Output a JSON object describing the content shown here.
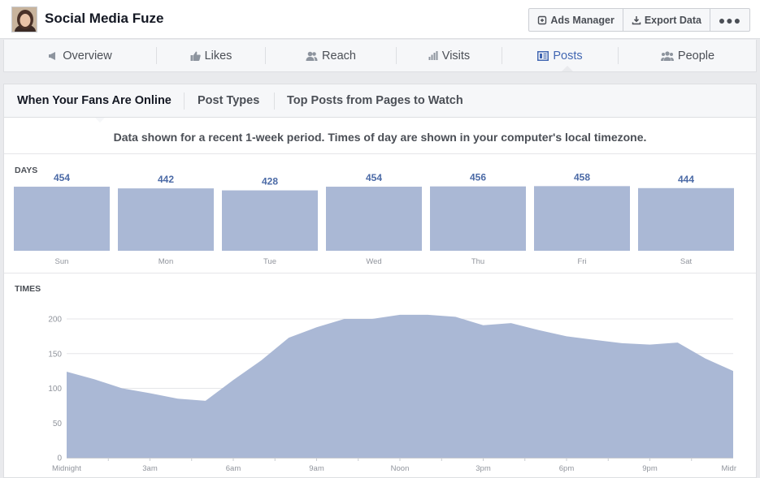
{
  "page": {
    "name": "Social Media Fuze"
  },
  "header_buttons": {
    "ads_manager": "Ads Manager",
    "export_data": "Export Data",
    "more": "●●●"
  },
  "nav": {
    "tabs": [
      {
        "label": "Overview",
        "icon": "megaphone-icon"
      },
      {
        "label": "Likes",
        "icon": "thumbs-up-icon"
      },
      {
        "label": "Reach",
        "icon": "people-icon"
      },
      {
        "label": "Visits",
        "icon": "bar-chart-icon"
      },
      {
        "label": "Posts",
        "icon": "posts-icon",
        "active": true
      },
      {
        "label": "People",
        "icon": "group-icon"
      }
    ]
  },
  "subtabs": [
    "When Your Fans Are Online",
    "Post Types",
    "Top Posts from Pages to Watch"
  ],
  "note": "Data shown for a recent 1-week period. Times of day are shown in your computer's local timezone.",
  "colors": {
    "bar": "#aab8d5",
    "value_label": "#4b6aa6",
    "active_tab": "#4267b2"
  },
  "chart_data": [
    {
      "type": "bar",
      "title": "DAYS",
      "categories": [
        "Sun",
        "Mon",
        "Tue",
        "Wed",
        "Thu",
        "Fri",
        "Sat"
      ],
      "values": [
        454,
        442,
        428,
        454,
        456,
        458,
        444
      ]
    },
    {
      "type": "area",
      "title": "TIMES",
      "x_ticks": [
        "Midnight",
        "3am",
        "6am",
        "9am",
        "Noon",
        "3pm",
        "6pm",
        "9pm",
        "Midr"
      ],
      "x": [
        0,
        1,
        2,
        3,
        4,
        5,
        6,
        7,
        8,
        9,
        10,
        11,
        12,
        13,
        14,
        15,
        16,
        17,
        18,
        19,
        20,
        21,
        22,
        23,
        24
      ],
      "values": [
        124,
        113,
        100,
        93,
        85,
        82,
        112,
        140,
        173,
        188,
        200,
        200,
        206,
        206,
        203,
        191,
        194,
        184,
        175,
        170,
        165,
        163,
        166,
        143,
        125
      ],
      "ylim": [
        0,
        200
      ],
      "yticks": [
        0,
        50,
        100,
        150,
        200
      ],
      "grid": true
    }
  ]
}
